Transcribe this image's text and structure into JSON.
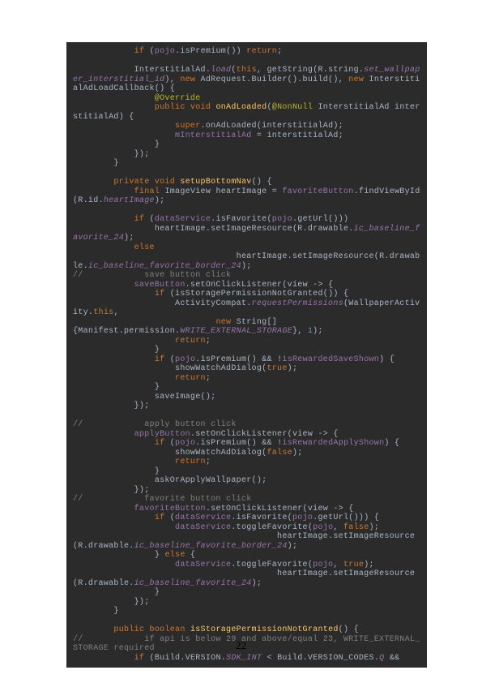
{
  "page_number": "22",
  "code": {
    "l1a": "            ",
    "l1b": "if",
    "l1c": " (",
    "l1d": "pojo",
    "l1e": ".isPremium()) ",
    "l1f": "return",
    "l1g": ";",
    "blank1": "",
    "l2a": "            InterstitialAd.",
    "l2b": "load",
    "l2c": "(",
    "l2d": "this",
    "l2e": ", getString(R.string.",
    "l2f": "set_wallpaper_interstitial_id",
    "l2g": "), ",
    "l2h": "new",
    "l3a": " AdRequest.Builder().build(), ",
    "l3b": "new",
    "l3c": " InterstitialAdLoadCallback() {",
    "l4a": "                ",
    "l4b": "@Override",
    "l5a": "                ",
    "l5b": "public void ",
    "l5c": "onAdLoaded",
    "l5d": "(",
    "l5e": "@NonNull",
    "l5f": " InterstitialAd interstitialAd) {",
    "l6a": "                    ",
    "l6b": "super",
    "l6c": ".onAdLoaded(interstitialAd);",
    "l7a": "                    ",
    "l7b": "mInterstitialAd",
    "l7c": " = interstitialAd;",
    "l8": "                }",
    "l9": "            });",
    "l10": "        }",
    "blank2": "",
    "l11a": "        ",
    "l11b": "private void ",
    "l11c": "setupBottomNav",
    "l11d": "() {",
    "l12a": "            ",
    "l12b": "final",
    "l12c": " ImageView heartImage = ",
    "l13a": "favoriteButton",
    "l13b": ".findViewById(R.id.",
    "l13c": "heartImage",
    "l13d": ");",
    "blank3": "",
    "l14a": "            ",
    "l14b": "if",
    "l14c": " (",
    "l14d": "dataService",
    "l14e": ".isFavorite(",
    "l14f": "pojo",
    "l14g": ".getUrl()))",
    "l15a": "                heartImage.setImageResource(R.drawable.",
    "l15b": "ic_baseline_favorite_24",
    "l15c": ");",
    "l16a": "            ",
    "l16b": "else",
    "l17a": "                heartImage.setImageResource(R.drawable.",
    "l17b": "ic_baseline_favorite_border_24",
    "l17c": ");",
    "l18a": "//            save button click",
    "l19a": "            ",
    "l19b": "saveButton",
    "l19c": ".setOnClickListener(view -> {",
    "l20a": "                ",
    "l20b": "if",
    "l20c": " (isStoragePermissionNotGranted()) {",
    "l21a": "                    ActivityCompat.",
    "l21b": "requestPermissions",
    "l21c": "(WallpaperActivity.",
    "l21d": "this",
    "l21e": ",",
    "l22a": "                            ",
    "l22b": "new",
    "l22c": " String[]",
    "l23a": "{Manifest.permission.",
    "l23b": "WRITE_EXTERNAL_STORAGE",
    "l23c": "}, ",
    "l23d": "1",
    "l23e": ");",
    "l24a": "                    ",
    "l24b": "return",
    "l24c": ";",
    "l25": "                }",
    "l26a": "                ",
    "l26b": "if",
    "l26c": " (",
    "l26d": "pojo",
    "l26e": ".isPremium() && !",
    "l26f": "isRewardedSaveShown",
    "l26g": ") {",
    "l27a": "                    showWatchAdDialog(",
    "l27b": "true",
    "l27c": ");",
    "l28a": "                    ",
    "l28b": "return",
    "l28c": ";",
    "l29": "                }",
    "l30": "                saveImage();",
    "l31": "            });",
    "blank4": "",
    "l32": "//            apply button click",
    "l33a": "            ",
    "l33b": "applyButton",
    "l33c": ".setOnClickListener(view -> {",
    "l34a": "                ",
    "l34b": "if",
    "l34c": " (",
    "l34d": "pojo",
    "l34e": ".isPremium() && !",
    "l34f": "isRewardedApplyShown",
    "l34g": ") {",
    "l35a": "                    showWatchAdDialog(",
    "l35b": "false",
    "l35c": ");",
    "l36a": "                    ",
    "l36b": "return",
    "l36c": ";",
    "l37": "                }",
    "l38": "                askOrApplyWallpaper();",
    "l39": "            });",
    "l40": "//            favorite button click",
    "l41a": "            ",
    "l41b": "favoriteButton",
    "l41c": ".setOnClickListener(view -> {",
    "l42a": "                ",
    "l42b": "if",
    "l42c": " (",
    "l42d": "dataService",
    "l42e": ".isFavorite(",
    "l42f": "pojo",
    "l42g": ".getUrl())) {",
    "l43a": "                    ",
    "l43b": "dataService",
    "l43c": ".toggleFavorite(",
    "l43d": "pojo",
    "l43e": ", ",
    "l43f": "false",
    "l43g": ");",
    "l44a": "                    heartImage.setImageResource(R.drawable.",
    "l44b": "ic_baseline_favorite_border_24",
    "l44c": ");",
    "l45a": "                } ",
    "l45b": "else",
    "l45c": " {",
    "l46a": "                    ",
    "l46b": "dataService",
    "l46c": ".toggleFavorite(",
    "l46d": "pojo",
    "l46e": ", ",
    "l46f": "true",
    "l46g": ");",
    "l47a": "                    heartImage.setImageResource(R.drawable.",
    "l47b": "ic_baseline_favorite_24",
    "l47c": ");",
    "l48": "                }",
    "l49": "            });",
    "l50": "        }",
    "blank5": "",
    "l51a": "        ",
    "l51b": "public boolean ",
    "l51c": "isStoragePermissionNotGranted",
    "l51d": "() {",
    "l52": "//            if api is below 29 and above/equal 23, WRITE_EXTERNAL_STORAGE required",
    "l53a": "            ",
    "l53b": "if",
    "l53c": " (Build.VERSION.",
    "l53d": "SDK_INT",
    "l53e": " < Build.VERSION_CODES.",
    "l53f": "Q",
    "l53g": " &&"
  }
}
